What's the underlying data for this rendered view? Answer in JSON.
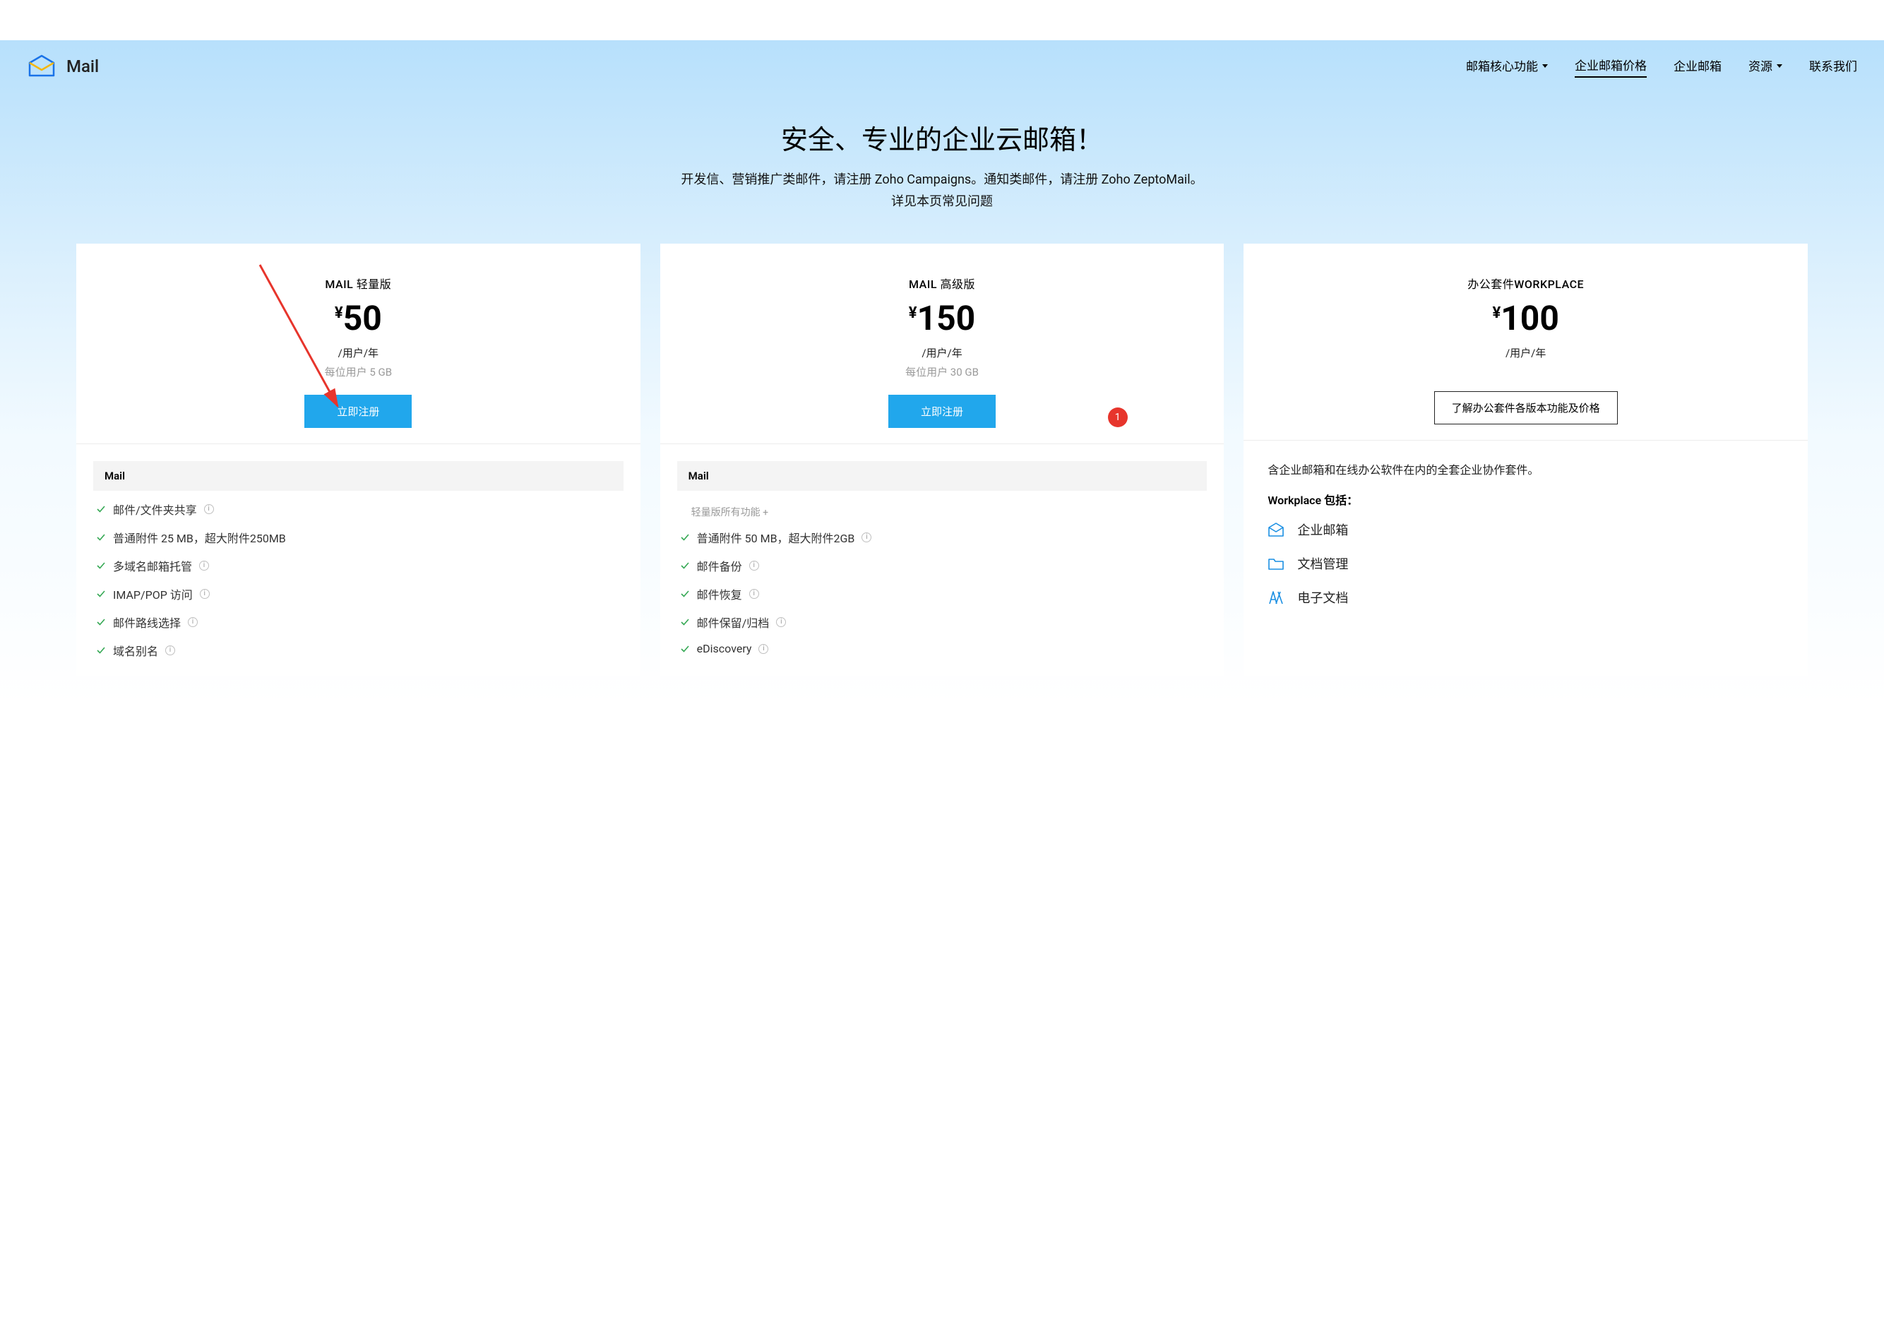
{
  "brand": "Mail",
  "nav": {
    "items": [
      {
        "label": "邮箱核心功能",
        "dropdown": true
      },
      {
        "label": "企业邮箱价格",
        "active": true
      },
      {
        "label": "企业邮箱"
      },
      {
        "label": "资源",
        "dropdown": true
      },
      {
        "label": "联系我们"
      }
    ]
  },
  "hero": {
    "title": "安全、专业的企业云邮箱！",
    "subtitle1": "开发信、营销推广类邮件，请注册 Zoho Campaigns。通知类邮件，请注册 Zoho ZeptoMail。",
    "subtitle2": "详见本页常见问题"
  },
  "annotation": {
    "badge": "1"
  },
  "plans": [
    {
      "name": "MAIL 轻量版",
      "currency": "¥",
      "amount": "50",
      "per": "/用户/年",
      "storage": "每位用户 5 GB",
      "cta": "立即注册",
      "feat_title": "Mail",
      "features": [
        {
          "text": "邮件/文件夹共享",
          "info": true
        },
        {
          "text": "普通附件 25 MB，超大附件250MB"
        },
        {
          "text": "多域名邮箱托管",
          "info": true
        },
        {
          "text": "IMAP/POP 访问",
          "info": true
        },
        {
          "text": "邮件路线选择",
          "info": true
        },
        {
          "text": "域名别名",
          "info": true
        }
      ]
    },
    {
      "name": "MAIL 高级版",
      "currency": "¥",
      "amount": "150",
      "per": "/用户/年",
      "storage": "每位用户 30 GB",
      "cta": "立即注册",
      "feat_title": "Mail",
      "feat_note": "轻量版所有功能 +",
      "features": [
        {
          "text": "普通附件 50 MB，超大附件2GB",
          "info": true
        },
        {
          "text": "邮件备份",
          "info": true
        },
        {
          "text": "邮件恢复",
          "info": true
        },
        {
          "text": "邮件保留/归档",
          "info": true
        },
        {
          "text": "eDiscovery",
          "info": true
        }
      ]
    },
    {
      "name": "办公套件WORKPLACE",
      "currency": "¥",
      "amount": "100",
      "per": "/用户/年",
      "cta_outline": "了解办公套件各版本功能及价格",
      "wp_desc": "含企业邮箱和在线办公软件在内的全套企业协作套件。",
      "wp_label": "Workplace 包括：",
      "wp_items": [
        {
          "icon": "mail",
          "text": "企业邮箱"
        },
        {
          "icon": "folder",
          "text": "文档管理"
        },
        {
          "icon": "docs",
          "text": "电子文档"
        }
      ]
    }
  ]
}
